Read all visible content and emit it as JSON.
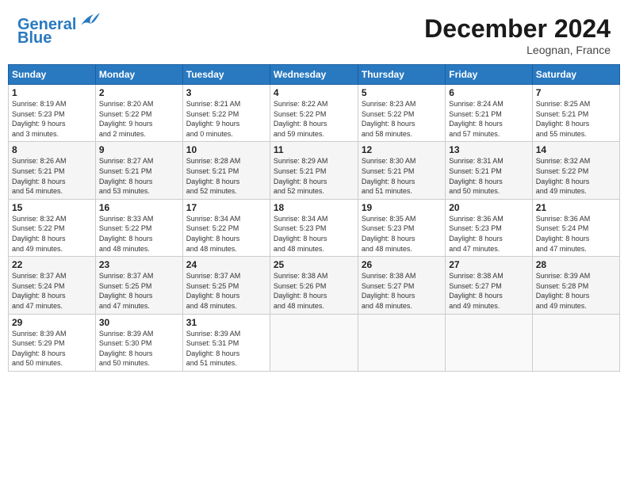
{
  "header": {
    "logo_line1": "General",
    "logo_line2": "Blue",
    "month": "December 2024",
    "location": "Leognan, France"
  },
  "days_of_week": [
    "Sunday",
    "Monday",
    "Tuesday",
    "Wednesday",
    "Thursday",
    "Friday",
    "Saturday"
  ],
  "weeks": [
    [
      {
        "day": "1",
        "info": "Sunrise: 8:19 AM\nSunset: 5:23 PM\nDaylight: 9 hours\nand 3 minutes."
      },
      {
        "day": "2",
        "info": "Sunrise: 8:20 AM\nSunset: 5:22 PM\nDaylight: 9 hours\nand 2 minutes."
      },
      {
        "day": "3",
        "info": "Sunrise: 8:21 AM\nSunset: 5:22 PM\nDaylight: 9 hours\nand 0 minutes."
      },
      {
        "day": "4",
        "info": "Sunrise: 8:22 AM\nSunset: 5:22 PM\nDaylight: 8 hours\nand 59 minutes."
      },
      {
        "day": "5",
        "info": "Sunrise: 8:23 AM\nSunset: 5:22 PM\nDaylight: 8 hours\nand 58 minutes."
      },
      {
        "day": "6",
        "info": "Sunrise: 8:24 AM\nSunset: 5:21 PM\nDaylight: 8 hours\nand 57 minutes."
      },
      {
        "day": "7",
        "info": "Sunrise: 8:25 AM\nSunset: 5:21 PM\nDaylight: 8 hours\nand 55 minutes."
      }
    ],
    [
      {
        "day": "8",
        "info": "Sunrise: 8:26 AM\nSunset: 5:21 PM\nDaylight: 8 hours\nand 54 minutes."
      },
      {
        "day": "9",
        "info": "Sunrise: 8:27 AM\nSunset: 5:21 PM\nDaylight: 8 hours\nand 53 minutes."
      },
      {
        "day": "10",
        "info": "Sunrise: 8:28 AM\nSunset: 5:21 PM\nDaylight: 8 hours\nand 52 minutes."
      },
      {
        "day": "11",
        "info": "Sunrise: 8:29 AM\nSunset: 5:21 PM\nDaylight: 8 hours\nand 52 minutes."
      },
      {
        "day": "12",
        "info": "Sunrise: 8:30 AM\nSunset: 5:21 PM\nDaylight: 8 hours\nand 51 minutes."
      },
      {
        "day": "13",
        "info": "Sunrise: 8:31 AM\nSunset: 5:21 PM\nDaylight: 8 hours\nand 50 minutes."
      },
      {
        "day": "14",
        "info": "Sunrise: 8:32 AM\nSunset: 5:22 PM\nDaylight: 8 hours\nand 49 minutes."
      }
    ],
    [
      {
        "day": "15",
        "info": "Sunrise: 8:32 AM\nSunset: 5:22 PM\nDaylight: 8 hours\nand 49 minutes."
      },
      {
        "day": "16",
        "info": "Sunrise: 8:33 AM\nSunset: 5:22 PM\nDaylight: 8 hours\nand 48 minutes."
      },
      {
        "day": "17",
        "info": "Sunrise: 8:34 AM\nSunset: 5:22 PM\nDaylight: 8 hours\nand 48 minutes."
      },
      {
        "day": "18",
        "info": "Sunrise: 8:34 AM\nSunset: 5:23 PM\nDaylight: 8 hours\nand 48 minutes."
      },
      {
        "day": "19",
        "info": "Sunrise: 8:35 AM\nSunset: 5:23 PM\nDaylight: 8 hours\nand 48 minutes."
      },
      {
        "day": "20",
        "info": "Sunrise: 8:36 AM\nSunset: 5:23 PM\nDaylight: 8 hours\nand 47 minutes."
      },
      {
        "day": "21",
        "info": "Sunrise: 8:36 AM\nSunset: 5:24 PM\nDaylight: 8 hours\nand 47 minutes."
      }
    ],
    [
      {
        "day": "22",
        "info": "Sunrise: 8:37 AM\nSunset: 5:24 PM\nDaylight: 8 hours\nand 47 minutes."
      },
      {
        "day": "23",
        "info": "Sunrise: 8:37 AM\nSunset: 5:25 PM\nDaylight: 8 hours\nand 47 minutes."
      },
      {
        "day": "24",
        "info": "Sunrise: 8:37 AM\nSunset: 5:25 PM\nDaylight: 8 hours\nand 48 minutes."
      },
      {
        "day": "25",
        "info": "Sunrise: 8:38 AM\nSunset: 5:26 PM\nDaylight: 8 hours\nand 48 minutes."
      },
      {
        "day": "26",
        "info": "Sunrise: 8:38 AM\nSunset: 5:27 PM\nDaylight: 8 hours\nand 48 minutes."
      },
      {
        "day": "27",
        "info": "Sunrise: 8:38 AM\nSunset: 5:27 PM\nDaylight: 8 hours\nand 49 minutes."
      },
      {
        "day": "28",
        "info": "Sunrise: 8:39 AM\nSunset: 5:28 PM\nDaylight: 8 hours\nand 49 minutes."
      }
    ],
    [
      {
        "day": "29",
        "info": "Sunrise: 8:39 AM\nSunset: 5:29 PM\nDaylight: 8 hours\nand 50 minutes."
      },
      {
        "day": "30",
        "info": "Sunrise: 8:39 AM\nSunset: 5:30 PM\nDaylight: 8 hours\nand 50 minutes."
      },
      {
        "day": "31",
        "info": "Sunrise: 8:39 AM\nSunset: 5:31 PM\nDaylight: 8 hours\nand 51 minutes."
      },
      null,
      null,
      null,
      null
    ]
  ]
}
